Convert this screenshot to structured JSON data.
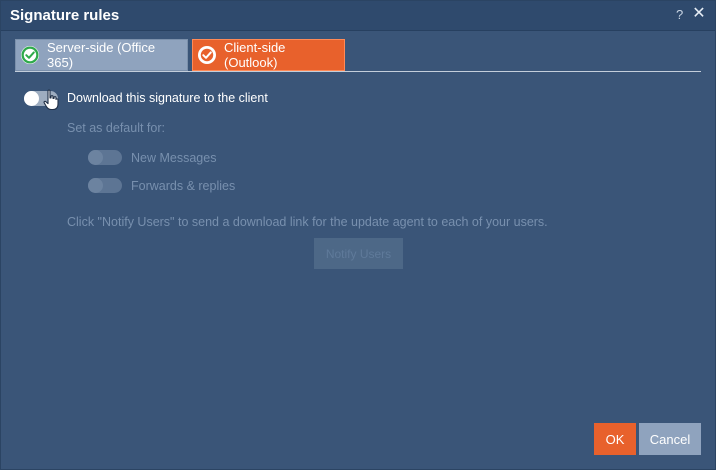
{
  "dialog": {
    "title": "Signature rules",
    "help_label": "?",
    "close_label": "✕"
  },
  "tabs": [
    {
      "label": "Server-side (Office 365)",
      "icon": "check-circle-green-icon",
      "selected": false
    },
    {
      "label": "Client-side (Outlook)",
      "icon": "check-circle-orange-icon",
      "selected": true
    }
  ],
  "client": {
    "download_label": "Download this signature to the client",
    "download_enabled": false,
    "default_for_label": "Set as default for:",
    "new_messages_label": "New Messages",
    "forwards_label": "Forwards & replies",
    "notify_text": "Click \"Notify Users\" to send a download link for the update agent to each of your users.",
    "notify_button_label": "Notify Users"
  },
  "footer": {
    "ok_label": "OK",
    "cancel_label": "Cancel"
  },
  "colors": {
    "accent": "#e8612c",
    "background": "#3a5578",
    "success": "#2eaa4a"
  }
}
